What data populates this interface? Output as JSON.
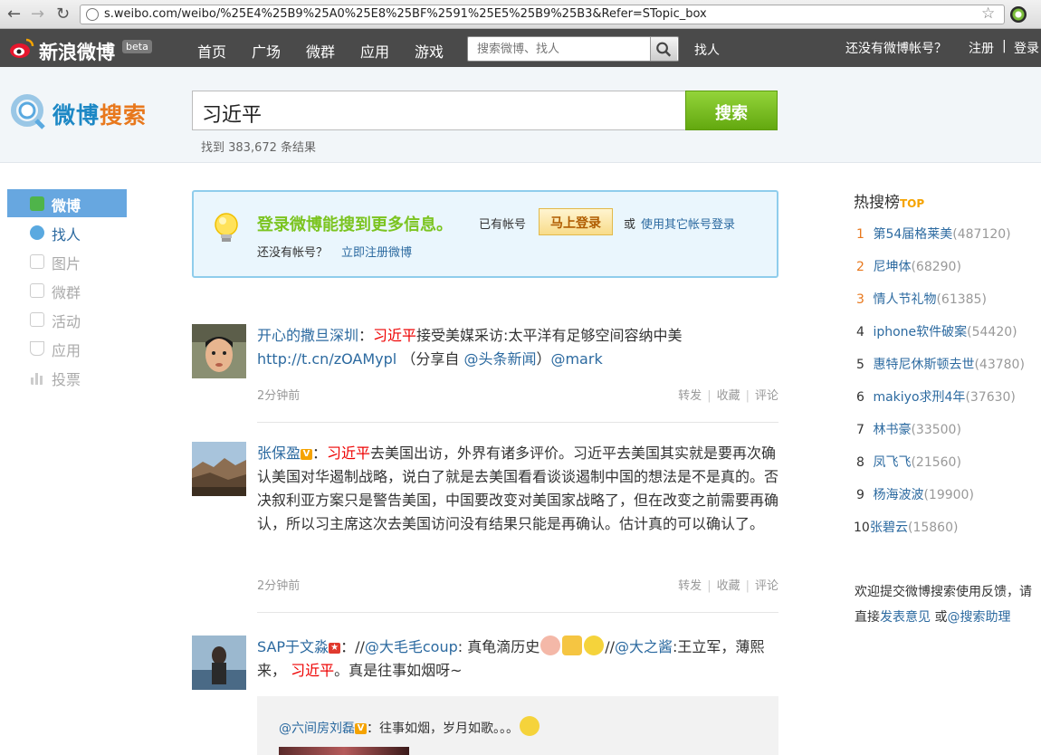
{
  "browser": {
    "url": "s.weibo.com/weibo/%25E4%25B9%25A0%25E8%25BF%2591%25E5%25B9%25B3&Refer=STopic_box"
  },
  "topnav": {
    "logo_text": "新浪微博",
    "beta": "beta",
    "links": [
      "首页",
      "广场",
      "微群",
      "应用",
      "游戏"
    ],
    "search_placeholder": "搜索微博、找人",
    "find_people": "找人",
    "no_account": "还没有微博帐号？",
    "register": "注册",
    "login": "登录"
  },
  "search": {
    "logo_part1": "微博",
    "logo_part2": "搜索",
    "query": "习近平",
    "button": "搜索",
    "result_count": "找到 383,672 条结果"
  },
  "sidebar": {
    "items": [
      {
        "label": "微博",
        "state": "active",
        "icon": "weibo-icon",
        "color": "#4fb44a"
      },
      {
        "label": "找人",
        "state": "link",
        "icon": "person-icon",
        "color": "#5aa9e0"
      },
      {
        "label": "图片",
        "state": "dim",
        "icon": "image-icon",
        "color": "#cccccc"
      },
      {
        "label": "微群",
        "state": "dim",
        "icon": "group-icon",
        "color": "#cccccc"
      },
      {
        "label": "活动",
        "state": "dim",
        "icon": "activity-icon",
        "color": "#cccccc"
      },
      {
        "label": "应用",
        "state": "dim",
        "icon": "flask-icon",
        "color": "#cccccc"
      },
      {
        "label": "投票",
        "state": "dim",
        "icon": "bar-chart-icon",
        "color": "#cccccc"
      }
    ]
  },
  "login_box": {
    "title": "登录微博能搜到更多信息。",
    "have_account": "已有帐号",
    "login_button": "马上登录",
    "or": "或",
    "other_login": "使用其它帐号登录",
    "no_account": "还没有帐号？",
    "register_link": "立即注册微博"
  },
  "posts": [
    {
      "user": "开心的撒旦深圳",
      "sep": "：",
      "highlight": "习近平",
      "text_a": "接受美媒采访:太平洋有足够空间容纳中美",
      "link": "http://t.cn/zOAMypl",
      "text_b": "（分享自",
      "mention": "@头条新闻",
      "text_c": "）",
      "mark": "@mark",
      "time": "2分钟前",
      "actions": [
        "转发",
        "收藏",
        "评论"
      ]
    },
    {
      "user": "张保盈",
      "badge": "V",
      "sep": "：",
      "highlight": "习近平",
      "text_a": "去美国出访，外界有诸多评价。习近平去美国其实就是要再次确认美国对华遏制战略，说白了就是去美国看看谈谈遏制中国的想法是不是真的。否决叙利亚方案只是警告美国，中国要改变对美国家战略了，但在改变之前需要再确认，所以习主席这次去美国访问没有结果只能是再确认。估计真的可以确认了。",
      "time": "2分钟前",
      "actions": [
        "转发",
        "收藏",
        "评论"
      ]
    },
    {
      "user": "SAP于文淼",
      "badge": "★",
      "sep": "：//",
      "mention1": "@大毛毛coup",
      "text_a": ": 真龟滴历史",
      "text_b": "//",
      "mention2": "@大之酱",
      "text_c": ":王立军，薄熙来，",
      "highlight": "习近平",
      "text_d": "。真是往事如烟呀~",
      "repost_user": "@六间房刘磊",
      "repost_badge": "V",
      "repost_text": "：往事如烟，岁月如歌。。。"
    }
  ],
  "hot": {
    "title": "热搜榜",
    "top": "TOP",
    "items": [
      {
        "rank": "1",
        "name": "第54届格莱美",
        "count": "(487120)"
      },
      {
        "rank": "2",
        "name": "尼坤体",
        "count": "(68290)"
      },
      {
        "rank": "3",
        "name": "情人节礼物",
        "count": "(61385)"
      },
      {
        "rank": "4",
        "name": "iphone软件破案",
        "count": "(54420)"
      },
      {
        "rank": "5",
        "name": "惠特尼休斯顿去世",
        "count": "(43780)"
      },
      {
        "rank": "6",
        "name": "makiyo求刑4年",
        "count": "(37630)"
      },
      {
        "rank": "7",
        "name": "林书豪",
        "count": "(33500)"
      },
      {
        "rank": "8",
        "name": "凤飞飞",
        "count": "(21560)"
      },
      {
        "rank": "9",
        "name": "杨海波波",
        "count": "(19900)"
      },
      {
        "rank": "10",
        "name": "张碧云",
        "count": "(15860)"
      }
    ]
  },
  "feedback": {
    "text_a": "欢迎提交微博搜索使用反馈，请直接",
    "link1": "发表意见",
    "text_b": "或",
    "link2": "@搜索助理"
  },
  "colors": {
    "accent_blue": "#2c6aa0",
    "highlight_red": "#e00000",
    "search_green": "#7bc420",
    "hot_orange": "#e8781d"
  }
}
